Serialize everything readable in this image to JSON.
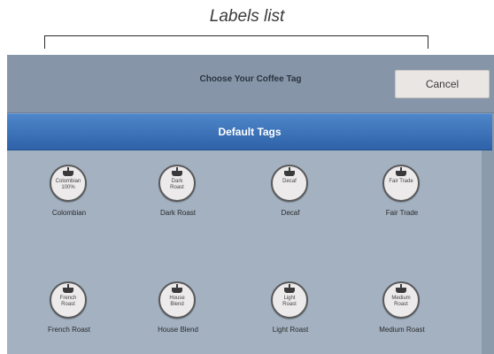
{
  "caption": "Labels list",
  "topbar": {
    "title": "Choose Your Coffee Tag",
    "cancel_label": "Cancel"
  },
  "section": {
    "title": "Default Tags"
  },
  "tags": [
    {
      "label": "Colombian",
      "medallion_line1": "Colombian",
      "medallion_line2": "100%"
    },
    {
      "label": "Dark Roast",
      "medallion_line1": "Dark",
      "medallion_line2": "Roast"
    },
    {
      "label": "Decaf",
      "medallion_line1": "Decaf",
      "medallion_line2": ""
    },
    {
      "label": "Fair Trade",
      "medallion_line1": "Fair Trade",
      "medallion_line2": ""
    },
    {
      "label": "French Roast",
      "medallion_line1": "French",
      "medallion_line2": "Roast"
    },
    {
      "label": "House Blend",
      "medallion_line1": "House",
      "medallion_line2": "Blend"
    },
    {
      "label": "Light Roast",
      "medallion_line1": "Light",
      "medallion_line2": "Roast"
    },
    {
      "label": "Medium Roast",
      "medallion_line1": "Medium",
      "medallion_line2": "Roast"
    }
  ],
  "colors": {
    "header_blue": "#3a70b8",
    "background": "#a3b1c1",
    "cancel_bg": "#e9e6e3"
  },
  "icons": {
    "tag_medallion": "coffee-cup-icon"
  }
}
